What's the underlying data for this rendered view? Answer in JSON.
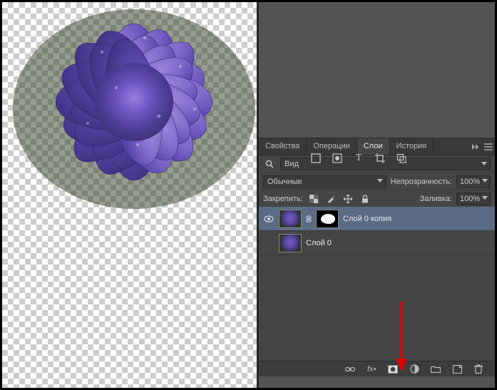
{
  "tabs": {
    "properties": "Свойства",
    "actions": "Операции",
    "layers": "Слои",
    "history": "История"
  },
  "filter": {
    "label": "Вид",
    "search_icon": "search"
  },
  "blend": {
    "mode": "Обычные",
    "opacity_label": "Непрозрачность:",
    "opacity_value": "100%"
  },
  "lock": {
    "label": "Закрепить:",
    "fill_label": "Заливка:",
    "fill_value": "100%"
  },
  "layers_list": [
    {
      "name": "Слой 0 копия",
      "visible": true,
      "selected": true,
      "has_mask": true
    },
    {
      "name": "Слой 0",
      "visible": false,
      "selected": false,
      "has_mask": false
    }
  ],
  "toolbar_icons": [
    "pointer",
    "rect-select",
    "text",
    "crop",
    "ruler"
  ],
  "bottom_icons": [
    "link",
    "fx",
    "mask",
    "adjustment",
    "group",
    "new-layer",
    "delete"
  ]
}
